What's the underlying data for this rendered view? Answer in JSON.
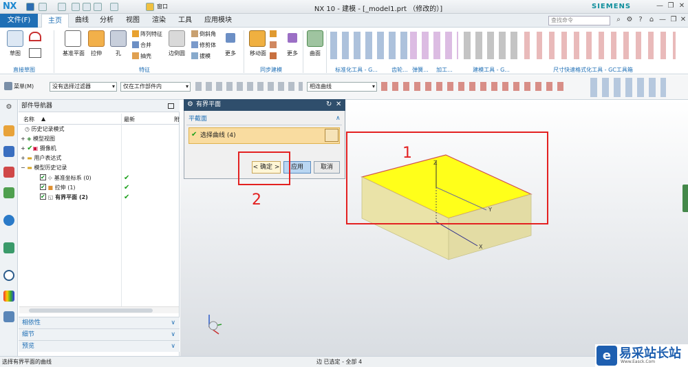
{
  "app": {
    "logo": "NX",
    "logo_suffix": "10",
    "title": "NX 10 - 建模 - [_model1.prt （修改的）]",
    "brand": "SIEMENS",
    "window_menu": "窗口"
  },
  "tabs": [
    {
      "label": "文件(F)"
    },
    {
      "label": "主页"
    },
    {
      "label": "曲线"
    },
    {
      "label": "分析"
    },
    {
      "label": "视图"
    },
    {
      "label": "渲染"
    },
    {
      "label": "工具"
    },
    {
      "label": "应用模块"
    }
  ],
  "search": {
    "placeholder": "查找命令"
  },
  "ribbon": {
    "sketch": "草图",
    "direct_sketch": "直接草图",
    "datum": "基准平面",
    "extrude": "拉伸",
    "hole": "孔",
    "pattern": "阵列特征",
    "unite": "合并",
    "shell": "抽壳",
    "edge_blend": "边倒圆",
    "chamfer": "倒斜角",
    "trim_body": "修剪体",
    "draft": "拔模",
    "more1": "更多",
    "feature": "特征",
    "move_face": "移动面",
    "more2": "更多",
    "sync": "同步建模",
    "surface": "曲面",
    "std_tools": "标准化工具 - G...",
    "gear": "齿轮...",
    "spring": "弹簧...",
    "machining": "加工...",
    "modeling_tools": "建模工具 - G...",
    "dim_tools": "尺寸快速格式化工具 - GC工具箱"
  },
  "toolbar": {
    "menu": "菜单(M)",
    "filter": "没有选择过滤器",
    "scope": "仅在工作部件内",
    "curve_rule": "相连曲线"
  },
  "navigator": {
    "title": "部件导航器",
    "col_name": "名称",
    "col_latest": "最新",
    "col_extra": "附",
    "items": [
      {
        "label": "历史记录模式"
      },
      {
        "label": "模型视图"
      },
      {
        "label": "摄像机"
      },
      {
        "label": "用户表达式"
      },
      {
        "label": "模型历史记录"
      },
      {
        "label": "基准坐标系 (0)"
      },
      {
        "label": "拉伸 (1)"
      },
      {
        "label": "有界平面 (2)"
      }
    ],
    "footer": [
      {
        "label": "相依性"
      },
      {
        "label": "细节"
      },
      {
        "label": "预览"
      }
    ]
  },
  "dialog": {
    "title": "有界平面",
    "section": "平截面",
    "select_curve": "选择曲线 (4)",
    "ok": "< 确定 >",
    "apply": "应用",
    "cancel": "取消"
  },
  "annotations": {
    "label1": "1",
    "label2": "2"
  },
  "viewport": {
    "axis_x": "X",
    "axis_y": "Y",
    "axis_z": "Z"
  },
  "status": {
    "left": "选择有界平面的曲线",
    "center": "边 已选定 - 全部 4"
  },
  "watermark": {
    "text": "易采站长站",
    "sub": "Www.Easck.Com"
  }
}
